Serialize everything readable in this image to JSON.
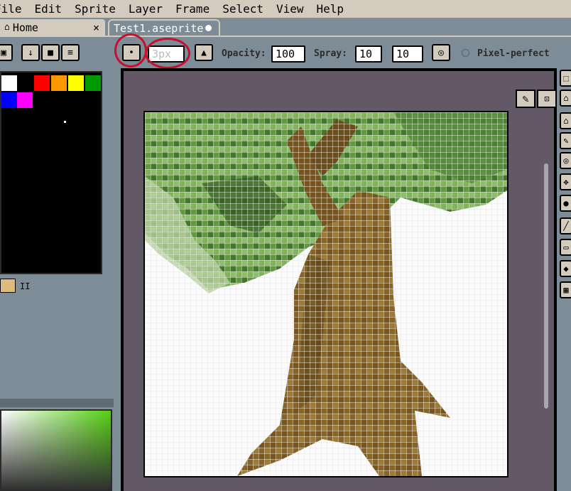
{
  "menu": [
    "File",
    "Edit",
    "Sprite",
    "Layer",
    "Frame",
    "Select",
    "View",
    "Help"
  ],
  "tabs": {
    "home": {
      "label": "Home",
      "close": "×",
      "icon": "home-icon"
    },
    "active": {
      "label": "Test1.aseprite",
      "status_icon": "modified-dot-icon"
    }
  },
  "toolbar": {
    "brush_type_glyph": "•",
    "brush_size": "3px",
    "brush_shape_icon": "brush-shape-icon",
    "opacity_label": "Opacity:",
    "opacity_value": "100",
    "spray_label": "Spray:",
    "spray_width": "10",
    "spray_speed": "10",
    "pixel_perfect_label": "Pixel-perfect",
    "annotation_color": "#c8102e"
  },
  "left_panel": {
    "lock_icon": "lock-icon",
    "buttons": [
      "↓",
      "■",
      "≡"
    ],
    "palette_colors": [
      "#ffffff",
      "#000000",
      "#ff0000",
      "#ff9900",
      "#ffff00",
      "#009900",
      "#0000ff",
      "#ff00ff"
    ],
    "fg_color": "#dcbc7e",
    "fg_label": "II"
  },
  "right_tools": [
    "⬚",
    "⌂",
    "✎",
    "◎",
    "✥",
    "●",
    "╱",
    "▭",
    "◆",
    "▦"
  ],
  "canvas_mini": {
    "pencil": "✎",
    "lock": "🔒"
  }
}
